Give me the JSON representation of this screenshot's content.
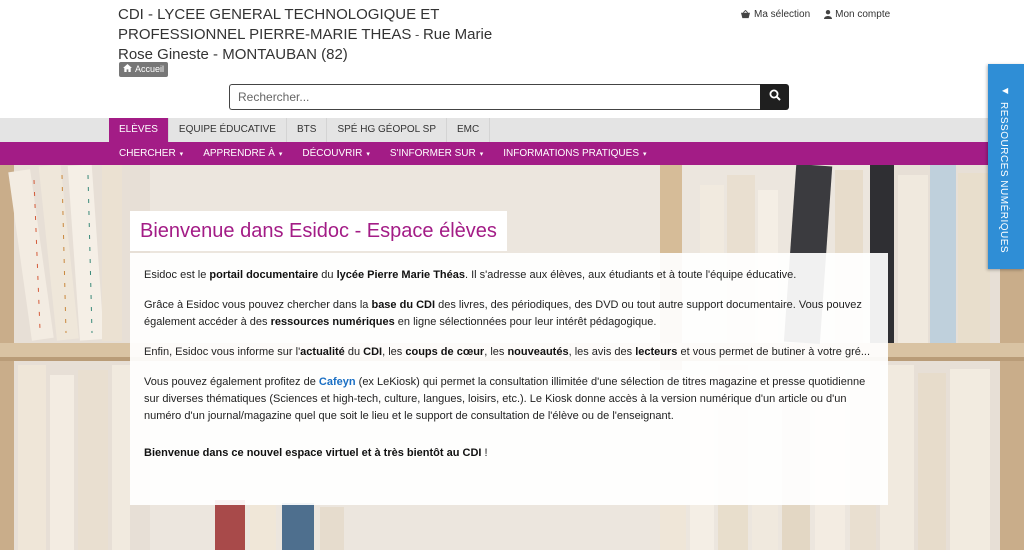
{
  "header": {
    "title_main": "CDI - LYCEE GENERAL TECHNOLOGIQUE ET PROFESSIONNEL PIERRE-MARIE THEAS",
    "title_sep": " - ",
    "title_address": "Rue Marie Rose Gineste - MONTAUBAN (82)",
    "home_label": "Accueil",
    "selection_label": "Ma sélection",
    "account_label": "Mon compte"
  },
  "search": {
    "placeholder": "Rechercher..."
  },
  "tabs": [
    {
      "label": "ELÈVES"
    },
    {
      "label": "EQUIPE ÉDUCATIVE"
    },
    {
      "label": "BTS"
    },
    {
      "label": "SPÉ HG GÉOPOL SP"
    },
    {
      "label": "EMC"
    }
  ],
  "nav": [
    {
      "label": "CHERCHER"
    },
    {
      "label": "APPRENDRE À"
    },
    {
      "label": "DÉCOUVRIR"
    },
    {
      "label": "S'INFORMER SUR"
    },
    {
      "label": "INFORMATIONS PRATIQUES"
    }
  ],
  "nav_caret": "▾",
  "welcome": {
    "title": "Bienvenue dans Esidoc - Espace élèves",
    "p1": {
      "t1": "Esidoc est le ",
      "b1": "portail documentaire",
      "t2": " du ",
      "b2": "lycée Pierre Marie Théas",
      "t3": ". Il s'adresse aux élèves, aux étudiants et à toute l'équipe éducative."
    },
    "p2": {
      "t1": "Grâce à Esidoc vous pouvez chercher dans la ",
      "b1": "base du CDI",
      "t2": " des livres, des périodiques, des DVD ou tout autre support documentaire. Vous pouvez également accéder à des ",
      "b2": "ressources numériques",
      "t3": " en ligne sélectionnées pour leur intérêt pédagogique."
    },
    "p3": {
      "t1": "Enfin, Esidoc vous informe sur l'",
      "b1": "actualité",
      "t2": " du ",
      "b2": "CDI",
      "t3": ", les ",
      "b3": "coups de cœur",
      "t4": ", les ",
      "b4": "nouveautés",
      "t5": ", les avis des ",
      "b5": "lecteurs",
      "t6": " et vous permet de butiner à votre gré..."
    },
    "p4": {
      "t1": "Vous pouvez également profitez de ",
      "link": "Cafeyn",
      "t2": " (ex LeKiosk) qui permet la consultation illimitée d'une sélection de titres magazine et presse quotidienne sur diverses thématiques (Sciences et high-tech, culture, langues, loisirs, etc.). Le Kiosk donne accès à la version numérique d'un article ou d'un numéro d'un journal/magazine quel que soit le lieu et le support de consultation de l'élève ou de l'enseignant."
    },
    "final": "Bienvenue dans ce nouvel espace virtuel et à très bientôt au CDI"
  },
  "final_suffix": " !",
  "side_tab": {
    "label": "RESSOURCES NUMÉRIQUES",
    "arrow": "◀"
  },
  "icons": {
    "home": "home-icon",
    "basket": "basket-icon",
    "user": "user-icon",
    "search": "search-icon"
  },
  "colors": {
    "accent": "#a31c86",
    "side_tab": "#2f8ed6",
    "link": "#1a6fc4"
  }
}
